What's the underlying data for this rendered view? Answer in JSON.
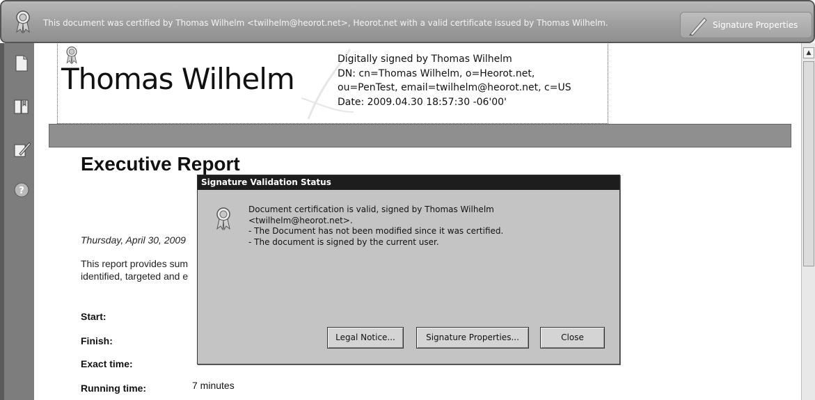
{
  "cert_bar": {
    "message": "This document was certified by Thomas Wilhelm <twilhelm@heorot.net>, Heorot.net with a valid certificate issued by Thomas Wilhelm.",
    "button_label": "Signature Properties"
  },
  "signature": {
    "name": "Thomas Wilhelm",
    "details": [
      "Digitally signed by Thomas Wilhelm",
      "DN: cn=Thomas Wilhelm, o=Heorot.net,",
      "ou=PenTest, email=twilhelm@heorot.net, c=US",
      "Date: 2009.04.30 18:57:30 -06'00'"
    ]
  },
  "report": {
    "title": "Executive Report",
    "date": "Thursday, April 30, 2009",
    "text_lines": [
      "This report provides sum",
      "identified, targeted and e"
    ],
    "rows": [
      {
        "key": "Start:",
        "value": ""
      },
      {
        "key": "Finish:",
        "value": ""
      },
      {
        "key": "Exact time:",
        "value": ""
      },
      {
        "key": "Running time:",
        "value": "7 minutes"
      }
    ]
  },
  "dialog": {
    "title": "Signature Validation Status",
    "message_lines": [
      "Document certification is valid, signed by Thomas Wilhelm",
      "<twilhelm@heorot.net>.",
      "- The Document has not been modified since it was certified.",
      "- The document is signed by the current user."
    ],
    "buttons": {
      "legal": "Legal Notice...",
      "properties": "Signature Properties...",
      "close": "Close"
    }
  },
  "icons": {
    "cert_ribbon": "certificate-ribbon-icon",
    "pen": "signature-pen-icon",
    "pages": "pages-icon",
    "bookmarks": "bookmarks-icon",
    "signatures": "signatures-icon",
    "help": "help-icon"
  }
}
